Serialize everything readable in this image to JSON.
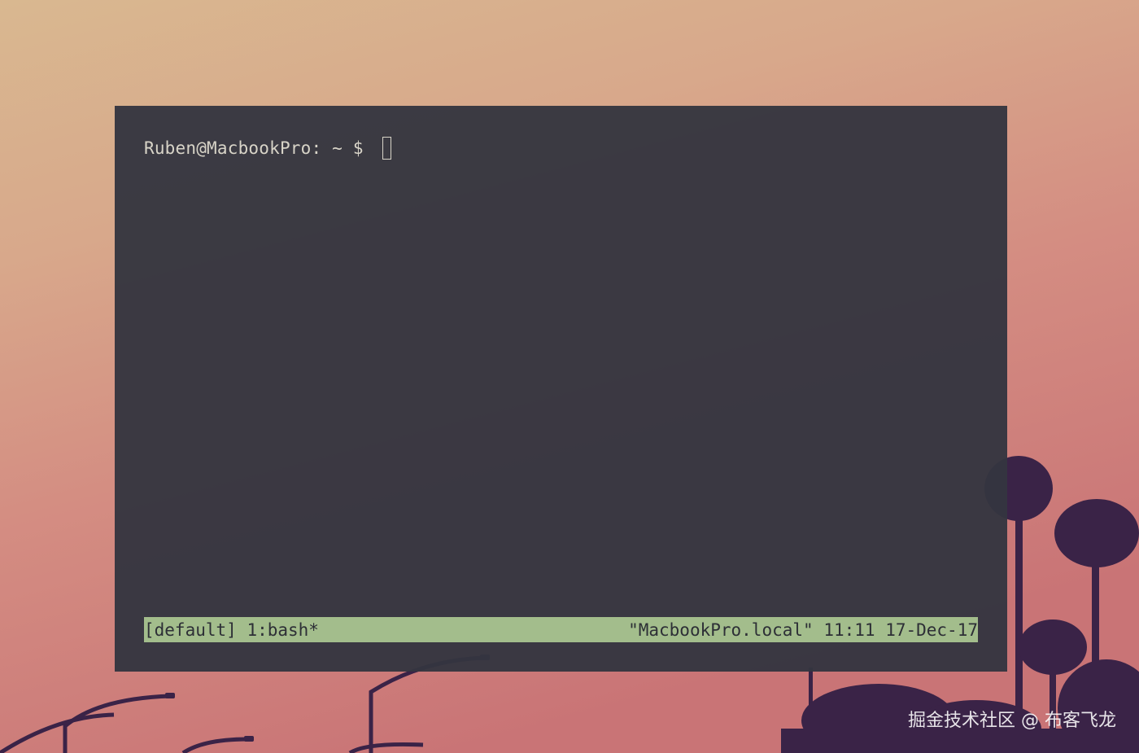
{
  "terminal": {
    "prompt": "Ruben@MacbookPro: ~ $ ",
    "status_bar": {
      "session": "[default]",
      "window": "1:bash*",
      "host": "\"MacbookPro.local\"",
      "time": "11:11",
      "date": "17-Dec-17"
    }
  },
  "watermark": "掘金技术社区 @ 布客飞龙",
  "colors": {
    "terminal_bg": "#34353f",
    "prompt_text": "#d8d4c8",
    "status_bar_bg": "#a3bd8c",
    "status_bar_text": "#2d2f36",
    "palm_silhouette": "#3a2347"
  }
}
